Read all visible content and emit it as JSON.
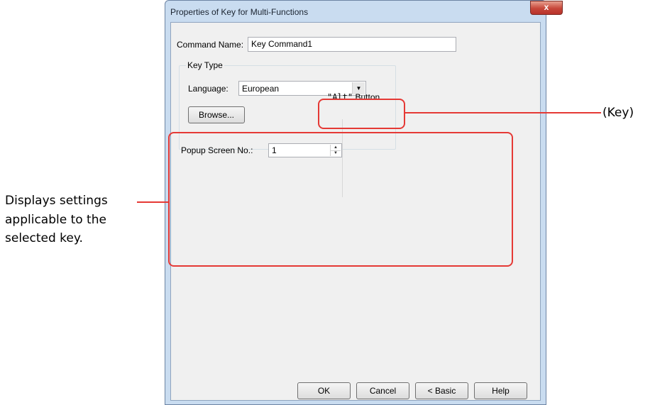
{
  "window": {
    "title": "Properties of Key for Multi-Functions",
    "close_label": "x"
  },
  "command": {
    "label": "Command Name:",
    "value": "Key Command1"
  },
  "key_type": {
    "group_label": "Key Type",
    "language_label": "Language:",
    "language_value": "European",
    "browse_label": "Browse...",
    "selected_key": "\"Alt\"",
    "selected_key_suffix": "Button"
  },
  "popup": {
    "label": "Popup Screen No.:",
    "value": "1"
  },
  "buttons": {
    "ok": "OK",
    "cancel": "Cancel",
    "basic": "< Basic",
    "help": "Help"
  },
  "annotations": {
    "key_callout": "(Key)",
    "settings_callout_line1": "Displays settings",
    "settings_callout_line2": "applicable to the",
    "settings_callout_line3": "selected key."
  },
  "colors": {
    "annotation_red": "#e53935",
    "dialog_frame": "#c9dcf0",
    "client_bg": "#f0f0f0"
  }
}
